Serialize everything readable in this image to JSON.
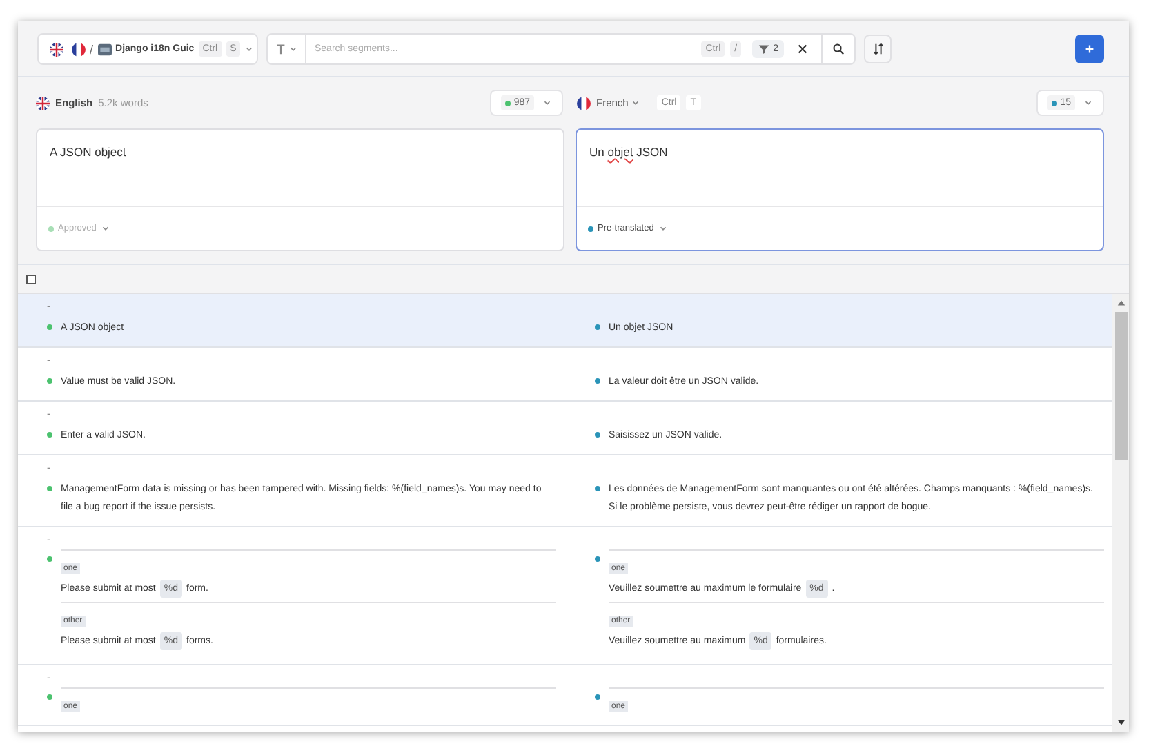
{
  "toolbar": {
    "project": {
      "separator": "/",
      "name": "Django i18n Guic",
      "shortcut": [
        "Ctrl",
        "S"
      ]
    },
    "search": {
      "placeholder": "Search segments...",
      "shortcut": [
        "Ctrl",
        "/"
      ],
      "filter_count": "2"
    }
  },
  "source": {
    "language": "English",
    "words": "5.2k words",
    "count": "987",
    "text": "A JSON object",
    "status": {
      "label": "Approved",
      "color": "#a8dfb6",
      "muted": true
    }
  },
  "target": {
    "language": "French",
    "shortcut": [
      "Ctrl",
      "T"
    ],
    "count": "15",
    "words": [
      {
        "text": "Un",
        "misspelled": false
      },
      {
        "text": "objet",
        "misspelled": true
      },
      {
        "text": "JSON",
        "misspelled": false
      }
    ],
    "status": {
      "label": "Pre-translated",
      "color": "#2a94b8",
      "muted": false
    }
  },
  "select_all": {
    "checked": false
  },
  "segments": [
    {
      "key": "-",
      "selected": true,
      "kind": "single",
      "source": "A JSON object",
      "target": "Un objet JSON"
    },
    {
      "key": "-",
      "selected": false,
      "kind": "single",
      "source": "Value must be valid JSON.",
      "target": "La valeur doit être un JSON valide."
    },
    {
      "key": "-",
      "selected": false,
      "kind": "single",
      "source": "Enter a valid JSON.",
      "target": "Saisissez un JSON valide."
    },
    {
      "key": "-",
      "selected": false,
      "kind": "single",
      "source": "ManagementForm data is missing or has been tampered with. Missing fields: %(field_names)s. You may need to file a bug report if the issue persists.",
      "target": "Les données de ManagementForm sont manquantes ou ont été altérées. Champs manquants : %(field_names)s. Si le problème persiste, vous devrez peut-être rédiger un rapport de bogue."
    },
    {
      "key": "-",
      "selected": false,
      "kind": "plural",
      "forms": [
        {
          "source_tag": "one",
          "target_tag": "one",
          "source": [
            {
              "kind": "text",
              "text": "Please submit at most"
            },
            {
              "kind": "placeholder",
              "text": "%d"
            },
            {
              "kind": "text",
              "text": "form."
            }
          ],
          "target": [
            {
              "kind": "text",
              "text": "Veuillez soumettre au maximum le formulaire"
            },
            {
              "kind": "placeholder",
              "text": "%d"
            },
            {
              "kind": "text",
              "text": "."
            }
          ]
        },
        {
          "source_tag": "other",
          "target_tag": "other",
          "source": [
            {
              "kind": "text",
              "text": "Please submit at most"
            },
            {
              "kind": "placeholder",
              "text": "%d"
            },
            {
              "kind": "text",
              "text": "forms."
            }
          ],
          "target": [
            {
              "kind": "text",
              "text": "Veuillez soumettre au maximum"
            },
            {
              "kind": "placeholder",
              "text": "%d"
            },
            {
              "kind": "text",
              "text": "formulaires."
            }
          ]
        }
      ]
    },
    {
      "key": "-",
      "selected": false,
      "kind": "plural",
      "forms": [
        {
          "source_tag": "one",
          "target_tag": "one"
        }
      ]
    }
  ]
}
